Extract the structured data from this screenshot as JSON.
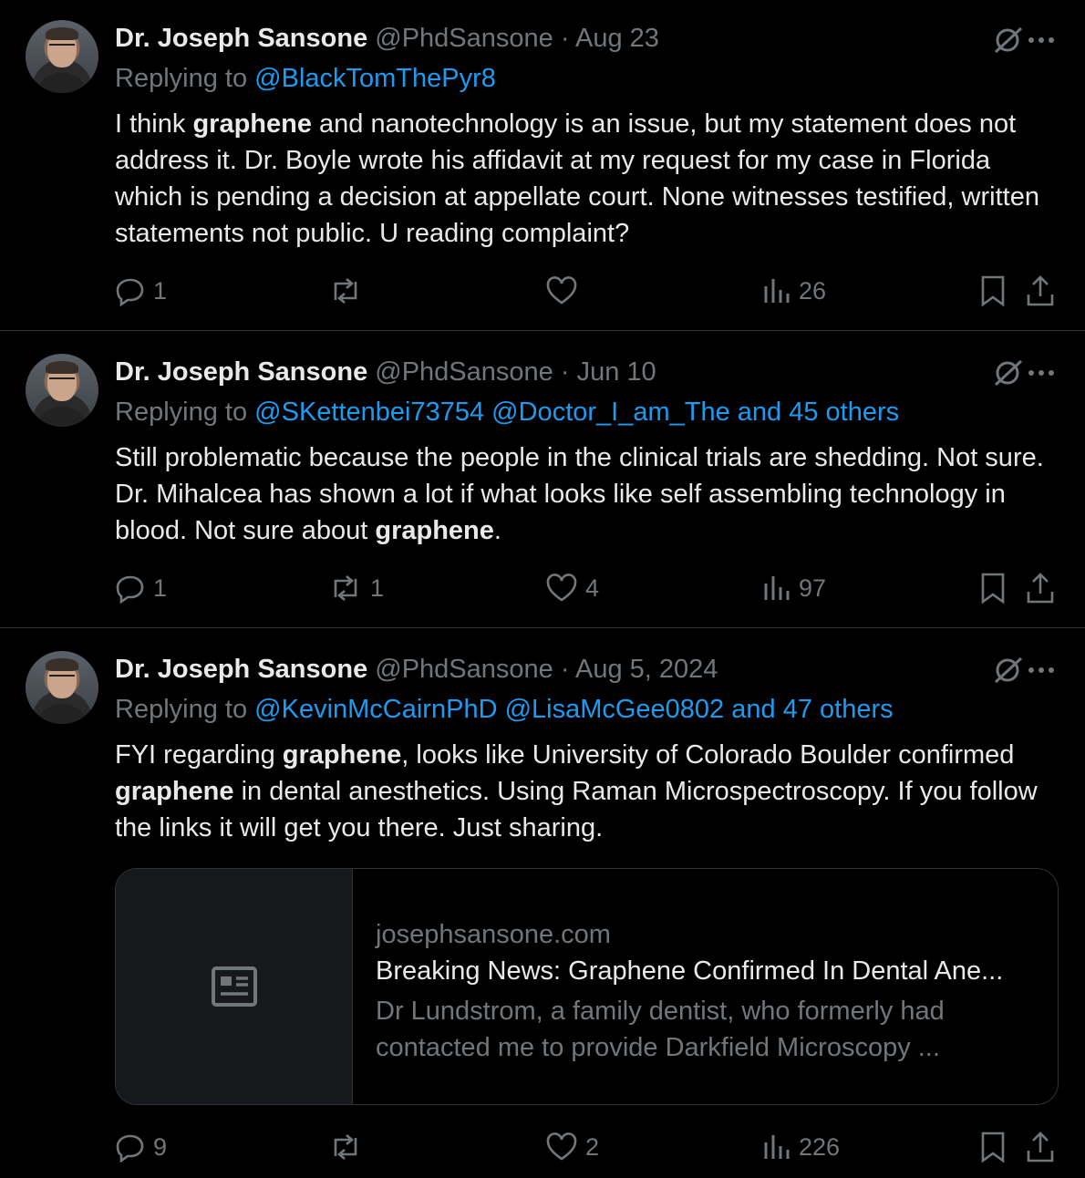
{
  "tweets": [
    {
      "name": "Dr. Joseph Sansone",
      "handle": "@PhdSansone",
      "sep": "·",
      "date": "Aug 23",
      "replying_label": "Replying to",
      "replying_to": "@BlackTomThePyr8",
      "text_parts": [
        "I think ",
        "graphene",
        " and nanotechnology is an issue, but my statement does not address it. Dr. Boyle wrote his affidavit at my request for my case in Florida which is pending a decision at appellate court.  None witnesses testified, written statements not public. U reading complaint?"
      ],
      "replies": "1",
      "reposts": "",
      "likes": "",
      "views": "26"
    },
    {
      "name": "Dr. Joseph Sansone",
      "handle": "@PhdSansone",
      "sep": "·",
      "date": "Jun 10",
      "replying_label": "Replying to",
      "replying_to": "@SKettenbei73754 @Doctor_I_am_The and 45 others",
      "text_parts": [
        "Still problematic because the people in the clinical trials are shedding. Not sure. Dr. Mihalcea has shown a lot if what looks like self assembling technology in blood. Not sure about ",
        "graphene",
        "."
      ],
      "replies": "1",
      "reposts": "1",
      "likes": "4",
      "views": "97"
    },
    {
      "name": "Dr. Joseph Sansone",
      "handle": "@PhdSansone",
      "sep": "·",
      "date": "Aug 5, 2024",
      "replying_label": "Replying to",
      "replying_to": "@KevinMcCairnPhD @LisaMcGee0802 and 47 others",
      "text_parts": [
        "FYI regarding ",
        "graphene",
        ", looks like University of Colorado Boulder confirmed ",
        "graphene",
        " in dental anesthetics. Using Raman Microspectroscopy. If you follow the links it will get you there. Just sharing."
      ],
      "card": {
        "domain": "josephsansone.com",
        "title": "Breaking News: Graphene Confirmed In Dental Ane...",
        "description": "Dr Lundstrom, a family dentist, who formerly had contacted me to provide Darkfield Microscopy ..."
      },
      "replies": "9",
      "reposts": "",
      "likes": "2",
      "views": "226"
    }
  ],
  "colors": {
    "background": "#000000",
    "text": "#e7e9ea",
    "muted": "#71767b",
    "link": "#1d9bf0",
    "divider": "#2f3336"
  },
  "icons": [
    "reply-icon",
    "repost-icon",
    "like-icon",
    "views-icon",
    "bookmark-icon",
    "share-icon",
    "grok-icon",
    "more-icon",
    "article-icon"
  ]
}
